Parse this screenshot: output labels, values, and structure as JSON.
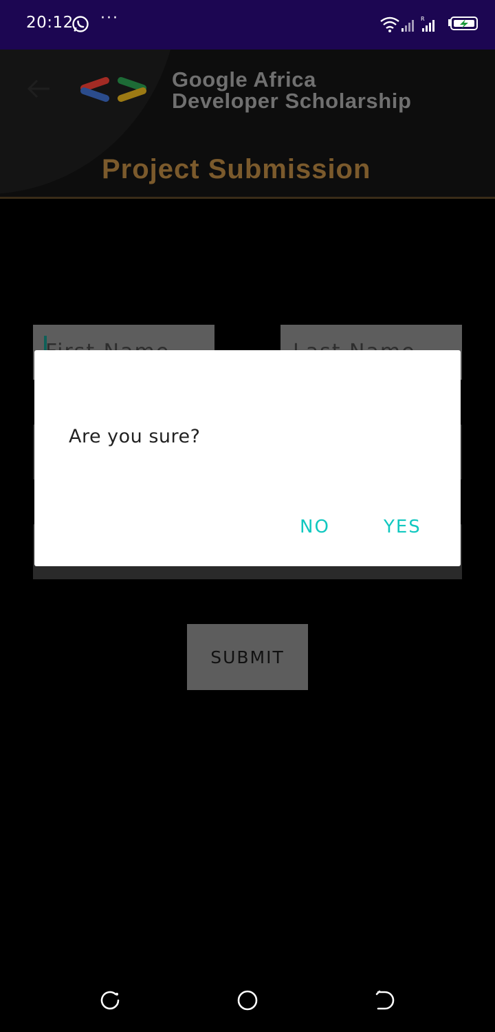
{
  "status_bar": {
    "time": "20:12",
    "notification_icons": [
      "whatsapp-icon",
      "more-dots-icon"
    ],
    "system_icons": [
      "wifi-icon",
      "signal-icon",
      "roaming-signal-icon",
      "battery-charging-icon"
    ],
    "dots": "···"
  },
  "header": {
    "back_icon": "arrow-left-icon",
    "logo": "gads-code-brackets-logo",
    "org_line1": "Google Africa",
    "org_line2": "Developer Scholarship",
    "page_title": "Project Submission",
    "colors": {
      "title": "#7b5a2c",
      "org": "#707070"
    }
  },
  "form": {
    "first_name_placeholder": "First Name",
    "last_name_placeholder": "Last Name",
    "submit_label": "SUBMIT"
  },
  "dialog": {
    "message": "Are you sure?",
    "negative_label": "NO",
    "positive_label": "YES",
    "accent_color": "#11c8c0"
  },
  "nav_bar": {
    "icons": [
      "recent-apps-icon",
      "home-icon",
      "back-icon"
    ]
  }
}
